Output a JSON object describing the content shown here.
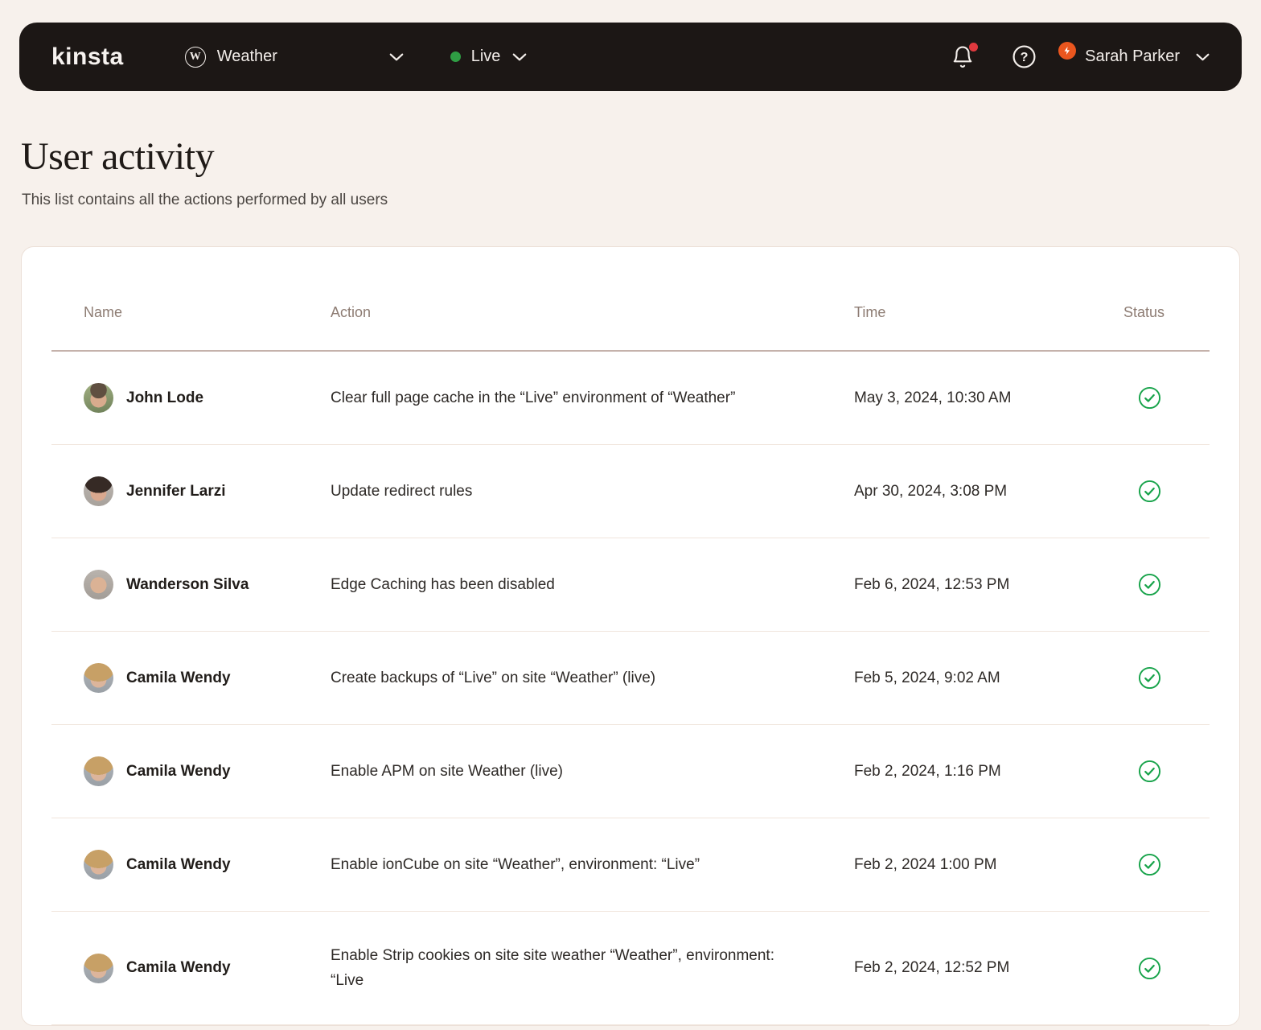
{
  "navbar": {
    "logo_text": "kinsta",
    "site_selector": {
      "label": "Weather",
      "icon": "wordpress-icon"
    },
    "env_selector": {
      "label": "Live",
      "status_color": "#2f9e44"
    },
    "notifications": {
      "has_unread": true
    },
    "user_name": "Sarah Parker"
  },
  "page": {
    "title": "User activity",
    "subtitle": "This list contains all the actions performed by all users"
  },
  "table": {
    "columns": [
      "Name",
      "Action",
      "Time",
      "Status"
    ],
    "rows": [
      {
        "name": "John Lode",
        "action": "Clear full page cache in the “Live” environment of “Weather”",
        "time": "May 3, 2024, 10:30 AM",
        "status": "success"
      },
      {
        "name": "Jennifer Larzi",
        "action": "Update redirect rules",
        "time": "Apr 30, 2024, 3:08 PM",
        "status": "success"
      },
      {
        "name": "Wanderson Silva",
        "action": "Edge Caching has been disabled",
        "time": "Feb 6, 2024, 12:53 PM",
        "status": "success"
      },
      {
        "name": "Camila Wendy",
        "action": "Create backups of “Live” on site “Weather” (live)",
        "time": "Feb 5, 2024, 9:02 AM",
        "status": "success"
      },
      {
        "name": "Camila Wendy",
        "action": "Enable APM on site Weather (live)",
        "time": "Feb 2, 2024, 1:16 PM",
        "status": "success"
      },
      {
        "name": "Camila Wendy",
        "action": "Enable ionCube on site “Weather”, environment: “Live”",
        "time": "Feb 2, 2024 1:00 PM",
        "status": "success"
      },
      {
        "name": "Camila Wendy",
        "action": "Enable Strip cookies on site site weather “Weather”, environment: “Live",
        "time": "Feb 2, 2024, 12:52 PM",
        "status": "success"
      }
    ]
  },
  "colors": {
    "page_bg": "#f7f1ec",
    "navbar_bg": "#1c1715",
    "navbar_text": "#f3eeea",
    "env_green": "#2f9e44",
    "success_green": "#17a34a",
    "notification_red": "#e0393e",
    "badge_orange": "#ea561e",
    "card_bg": "#ffffff",
    "card_border": "#ece0d8",
    "row_divider": "#f0e5dc",
    "header_divider": "#c5b2ab",
    "header_text": "#8d7c73",
    "title_text": "#1f1a17",
    "subtitle_text": "#4b4642",
    "body_text": "#2e2a27"
  }
}
